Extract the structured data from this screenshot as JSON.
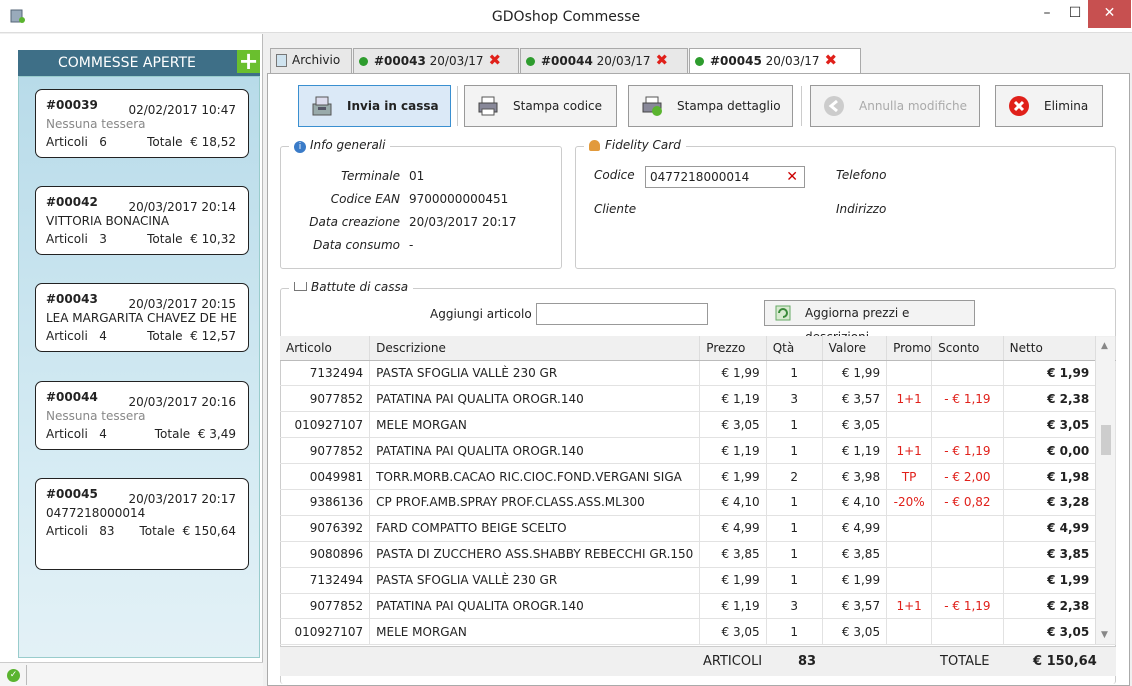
{
  "window": {
    "title": "GDOshop Commesse"
  },
  "sidebar": {
    "title": "COMMESSE APERTE",
    "add_label": "+",
    "cards": [
      {
        "id": "#00039",
        "date": "02/02/2017 10:47",
        "line2": "Nessuna tessera",
        "articoli_label": "Articoli",
        "articoli": "6",
        "totale_label": "Totale",
        "totale": "€ 18,52"
      },
      {
        "id": "#00042",
        "date": "20/03/2017 20:14",
        "line2": "VITTORIA BONACINA",
        "articoli_label": "Articoli",
        "articoli": "3",
        "totale_label": "Totale",
        "totale": "€ 10,32"
      },
      {
        "id": "#00043",
        "date": "20/03/2017 20:15",
        "line2": "LEA MARGARITA CHAVEZ DE HE",
        "articoli_label": "Articoli",
        "articoli": "4",
        "totale_label": "Totale",
        "totale": "€ 12,57"
      },
      {
        "id": "#00044",
        "date": "20/03/2017 20:16",
        "line2": "Nessuna tessera",
        "articoli_label": "Articoli",
        "articoli": "4",
        "totale_label": "Totale",
        "totale": "€ 3,49"
      },
      {
        "id": "#00045",
        "date": "20/03/2017 20:17",
        "line2": "0477218000014",
        "articoli_label": "Articoli",
        "articoli": "83",
        "totale_label": "Totale",
        "totale": "€ 150,64"
      }
    ]
  },
  "tabs": [
    {
      "label": "Archivio"
    },
    {
      "num": "#00043",
      "date": "20/03/17"
    },
    {
      "num": "#00044",
      "date": "20/03/17"
    },
    {
      "num": "#00045",
      "date": "20/03/17"
    }
  ],
  "toolbar": {
    "invia": "Invia in cassa",
    "stampa_codice": "Stampa codice",
    "stampa_dettaglio": "Stampa dettaglio",
    "annulla": "Annulla modifiche",
    "elimina": "Elimina"
  },
  "info": {
    "title": "Info generali",
    "terminale_label": "Terminale",
    "terminale": "01",
    "ean_label": "Codice EAN",
    "ean": "9700000000451",
    "creazione_label": "Data creazione",
    "creazione": "20/03/2017 20:17",
    "consumo_label": "Data consumo",
    "consumo": "-"
  },
  "fidelity": {
    "title": "Fidelity Card",
    "codice_label": "Codice",
    "codice": "0477218000014",
    "cliente_label": "Cliente",
    "telefono_label": "Telefono",
    "indirizzo_label": "Indirizzo"
  },
  "battute": {
    "title": "Battute di cassa",
    "aggiungi_label": "Aggiungi articolo",
    "aggiorna": "Aggiorna prezzi e descrizioni",
    "columns": [
      "Articolo",
      "Descrizione",
      "Prezzo",
      "Qtà",
      "Valore",
      "Promo",
      "Sconto",
      "Netto"
    ],
    "rows": [
      [
        "7132494",
        "PASTA SFOGLIA VALLÈ 230 GR",
        "€ 1,99",
        "1",
        "€ 1,99",
        "",
        "",
        "€ 1,99"
      ],
      [
        "9077852",
        "PATATINA PAI QUALITA OROGR.140",
        "€ 1,19",
        "3",
        "€ 3,57",
        "1+1",
        "- € 1,19",
        "€ 2,38"
      ],
      [
        "010927107",
        "MELE MORGAN",
        "€ 3,05",
        "1",
        "€ 3,05",
        "",
        "",
        "€ 3,05"
      ],
      [
        "9077852",
        "PATATINA PAI QUALITA OROGR.140",
        "€ 1,19",
        "1",
        "€ 1,19",
        "1+1",
        "- € 1,19",
        "€ 0,00"
      ],
      [
        "0049981",
        "TORR.MORB.CACAO RIC.CIOC.FOND.VERGANI SIGA",
        "€ 1,99",
        "2",
        "€ 3,98",
        "TP",
        "- € 2,00",
        "€ 1,98"
      ],
      [
        "9386136",
        "CP PROF.AMB.SPRAY PROF.CLASS.ASS.ML300",
        "€ 4,10",
        "1",
        "€ 4,10",
        "-20%",
        "- € 0,82",
        "€ 3,28"
      ],
      [
        "9076392",
        "FARD COMPATTO BEIGE SCELTO",
        "€ 4,99",
        "1",
        "€ 4,99",
        "",
        "",
        "€ 4,99"
      ],
      [
        "9080896",
        "PASTA DI ZUCCHERO ASS.SHABBY REBECCHI GR.150",
        "€ 3,85",
        "1",
        "€ 3,85",
        "",
        "",
        "€ 3,85"
      ],
      [
        "7132494",
        "PASTA SFOGLIA VALLÈ 230 GR",
        "€ 1,99",
        "1",
        "€ 1,99",
        "",
        "",
        "€ 1,99"
      ],
      [
        "9077852",
        "PATATINA PAI QUALITA OROGR.140",
        "€ 1,19",
        "3",
        "€ 3,57",
        "1+1",
        "- € 1,19",
        "€ 2,38"
      ],
      [
        "010927107",
        "MELE MORGAN",
        "€ 3,05",
        "1",
        "€ 3,05",
        "",
        "",
        "€ 3,05"
      ]
    ],
    "articoli_label": "ARTICOLI",
    "articoli": "83",
    "totale_label": "TOTALE",
    "totale": "€ 150,64"
  },
  "colors": {
    "accent": "#3e6f87",
    "danger": "#e0201a",
    "ok": "#2e9c2e"
  }
}
